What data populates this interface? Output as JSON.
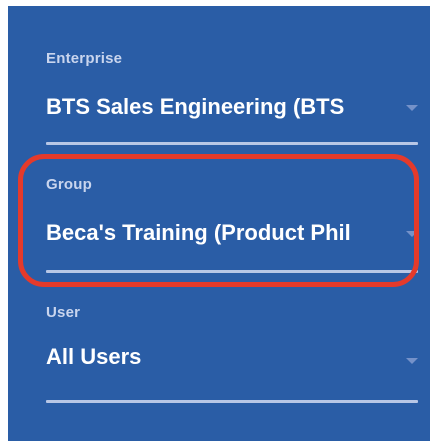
{
  "filters": {
    "enterprise": {
      "label": "Enterprise",
      "value": "BTS Sales Engineering (BTS"
    },
    "group": {
      "label": "Group",
      "value": "Beca's Training (Product Phil"
    },
    "user": {
      "label": "User",
      "value": "All Users"
    }
  },
  "icons": {
    "dropdown": "chevron-down-icon"
  },
  "colors": {
    "panel_background": "#2a5da6",
    "label_text": "#c9d5ee",
    "value_text": "#ffffff",
    "underline": "#b8c7e6",
    "highlight": "#e43a2b"
  }
}
